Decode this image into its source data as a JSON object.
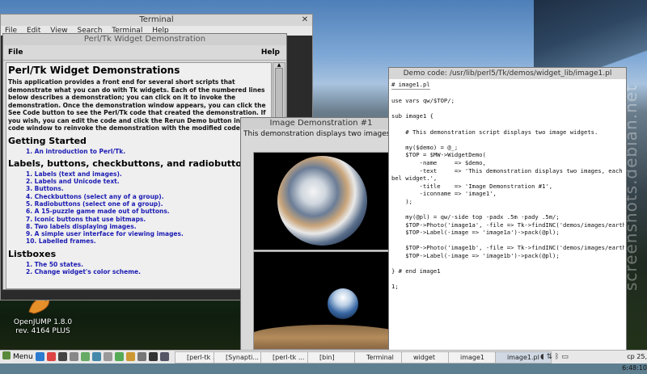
{
  "desktop": {
    "watermark": "screenshots.debian.net",
    "icon_label": "OpenJUMP 1.8.0 rev. 4164 PLUS"
  },
  "terminal": {
    "title": "Terminal",
    "menu": [
      "File",
      "Edit",
      "View",
      "Search",
      "Terminal",
      "Help"
    ]
  },
  "widget_demo": {
    "title": "Perl/Tk Widget Demonstration",
    "menu_file": "File",
    "menu_help": "Help",
    "heading": "Perl/Tk Widget Demonstrations",
    "intro": "This application provides a front end for several short scripts that demonstrate what you can do with Tk widgets.  Each of the numbered lines below describes a demonstration;  you can click on it to invoke the demonstration.  Once the demonstration window appears, you can click the See Code button to see the Perl/Tk code that created the demonstration.  If you wish, you can edit the code and click the Rerun Demo button in the code window to reinvoke the demonstration with the modified code.",
    "sections": [
      {
        "title": "Getting Started",
        "items": [
          "1. An introduction to Perl/Tk."
        ]
      },
      {
        "title": "Labels, buttons, checkbuttons, and radiobuttons",
        "items": [
          "1. Labels (text and images).",
          "2. Labels and Unicode text.",
          "3. Buttons.",
          "4. Checkbuttons (select any of a group).",
          "5. Radiobuttons (select one of a group).",
          "6. A 15-puzzle game made out of buttons.",
          "7. Iconic buttons that use bitmaps.",
          "8. Two labels displaying images.",
          "9. A simple user interface for viewing images.",
          "10. Labelled frames."
        ]
      },
      {
        "title": "Listboxes",
        "items": [
          "1. The 50 states.",
          "2. Change widget's color scheme."
        ]
      }
    ]
  },
  "image_demo": {
    "title": "Image Demonstration #1",
    "caption": "This demonstration displays two images, each in a separate label widget."
  },
  "code_window": {
    "title": "Demo code: /usr/lib/perl5/Tk/demos/widget_lib/image1.pl",
    "lines": [
      "# image1.pl",
      "",
      "use vars qw/$TOP/;",
      "",
      "sub image1 {",
      "",
      "    # This demonstration script displays two image widgets.",
      "",
      "    my($demo) = @_;",
      "    $TOP = $MW->WidgetDemo(",
      "        -name     => $demo,",
      "        -text     => 'This demonstration displays two images, each in a separate la",
      "bel widget.',",
      "        -title    => 'Image Demonstration #1',",
      "        -iconname => 'image1',",
      "    );",
      "",
      "    my(@pl) = qw/-side top -padx .5m -pady .5m/;",
      "    $TOP->Photo('image1a', -file => Tk->findINC('demos/images/earth.gif'));",
      "    $TOP->Label(-image => 'image1a')->pack(@pl);",
      "",
      "    $TOP->Photo('image1b', -file => Tk->findINC('demos/images/earthris.gif'));",
      "    $TOP->Label(-image => 'image1b')->pack(@pl);",
      "",
      "} # end image1",
      "",
      "1;"
    ]
  },
  "taskbar": {
    "menu_label": "Menu",
    "tasks": [
      "[perl-tk ...",
      "[Synapti...",
      "[perl-tk ...",
      "[bin]",
      "Terminal",
      "widget",
      "image1",
      "image1.pl"
    ],
    "clock": "ср 25, 6:48:10"
  },
  "colors": {
    "link": "#1c1cb4",
    "window_bg": "#d9d9d9",
    "taskbar_bg": "#e8e8e8"
  }
}
